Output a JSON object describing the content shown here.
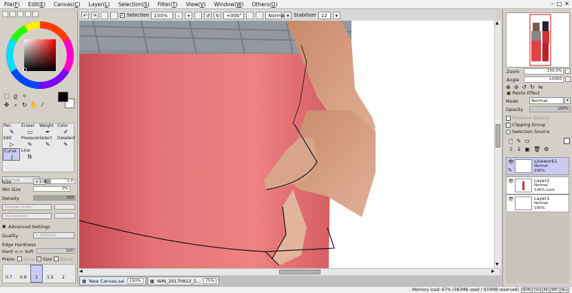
{
  "menu": {
    "items": [
      {
        "name": "File",
        "key": "F"
      },
      {
        "name": "Edit",
        "key": "E"
      },
      {
        "name": "Canvas",
        "key": "C"
      },
      {
        "name": "Layer",
        "key": "L"
      },
      {
        "name": "Selection",
        "key": "S"
      },
      {
        "name": "Filter",
        "key": "T"
      },
      {
        "name": "View",
        "key": "V"
      },
      {
        "name": "Window",
        "key": "W"
      },
      {
        "name": "Others",
        "key": "O"
      }
    ],
    "min": "–",
    "max": "□",
    "close": "✕"
  },
  "toolbar": {
    "selection_label": "Selection",
    "zoom": "150%",
    "rotation": "+000°",
    "blend": "Normal",
    "stabilizer_label": "Stabilizer",
    "stabilizer": "12"
  },
  "tools": {
    "pen": "Pen",
    "eraser": "Eraser",
    "weight": "Weight",
    "color": "Color",
    "edit": "Edit",
    "pressure": "Pressure",
    "select": "Select",
    "deselect": "Deselect",
    "curve": "Curve",
    "line": "Line"
  },
  "brush": {
    "mode": "Normal",
    "size_label": "Size",
    "size_mult": "x 1.0",
    "size": "1.0",
    "min_size_label": "Min Size",
    "min_size": "0%",
    "density_label": "Density",
    "density": "100",
    "shape": "(simple circle)",
    "texture": "(no texture)",
    "advanced_label": "Advanced Settings",
    "quality_label": "Quality",
    "quality": "1 (Fastest)",
    "edge_label": "Edge Hardness",
    "hard_soft_label": "Hard <-> Soft",
    "hard_soft": "100",
    "press_label": "Press:",
    "dens_label": "Dens",
    "size_chk": "Size",
    "blend_chk": "Blend",
    "presets": [
      "0.7",
      "0.8",
      "1",
      "1.5",
      "2"
    ]
  },
  "tabs": [
    {
      "name": "New Canvas.sai",
      "zoom": "150%"
    },
    {
      "name": "WIN_20170813_2...",
      "zoom": "75%"
    }
  ],
  "status": {
    "memory": "Memory load: 67% (383MB used / 933MB reserved)",
    "keys": [
      "Shift",
      "Ctrl",
      "Alt",
      "SPC",
      "Any"
    ]
  },
  "navigator": {
    "zoom_label": "Zoom",
    "zoom": "150.0%",
    "angle_label": "Angle",
    "angle": "+0000"
  },
  "layers_panel": {
    "paints_effect": "Paints Effect",
    "mode_label": "Mode",
    "mode": "Normal",
    "opacity_label": "Opacity",
    "opacity": "100%",
    "preserve": "Preserve Opacity",
    "clipping": "Clipping Group",
    "source": "Selection Source",
    "layers": [
      {
        "name": "Linework1",
        "mode": "Normal",
        "opacity": "100%"
      },
      {
        "name": "Layer2",
        "mode": "Normal",
        "opacity": "100% Lock"
      },
      {
        "name": "Layer1",
        "mode": "Normal",
        "opacity": "100%"
      }
    ]
  }
}
